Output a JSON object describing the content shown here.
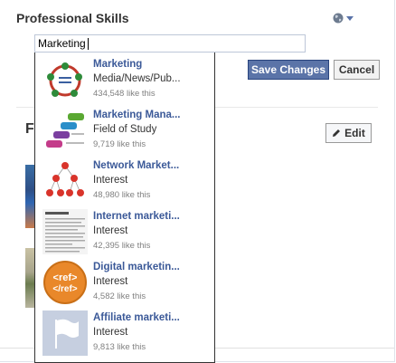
{
  "section": {
    "title": "Professional Skills"
  },
  "privacy": {
    "icon": "globe-icon"
  },
  "search": {
    "value": "Marketing"
  },
  "actions": {
    "save_label": "Save Changes",
    "cancel_label": "Cancel"
  },
  "background_section": {
    "heading_partial": "F",
    "edit_label": "Edit"
  },
  "suggestions": [
    {
      "name": "Marketing",
      "category": "Media/News/Pub...",
      "likes": "434,548 like this",
      "thumb": "cycle-diagram"
    },
    {
      "name": "Marketing Mana...",
      "category": "Field of Study",
      "likes": "9,719 like this",
      "thumb": "steps-diagram"
    },
    {
      "name": "Network Market...",
      "category": "Interest",
      "likes": "48,980 like this",
      "thumb": "network-tree"
    },
    {
      "name": "Internet marketi...",
      "category": "Interest",
      "likes": "42,395 like this",
      "thumb": "document"
    },
    {
      "name": "Digital marketin...",
      "category": "Interest",
      "likes": "4,582 like this",
      "thumb": "ref-badge",
      "thumb_text_1": "<ref>",
      "thumb_text_2": "</ref>"
    },
    {
      "name": "Affiliate marketi...",
      "category": "Interest",
      "likes": "9,813 like this",
      "thumb": "flag"
    }
  ],
  "colors": {
    "link": "#3b5998",
    "save_button": "#5b74a8",
    "dropdown_border": "#333333"
  }
}
